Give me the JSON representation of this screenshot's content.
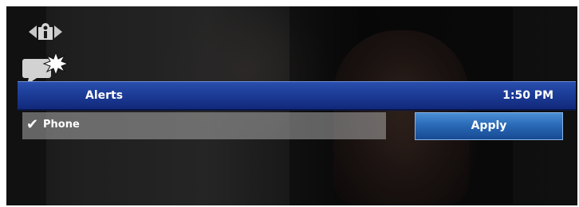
{
  "header": {
    "info_icon": "info-icon",
    "alert_icon": "new-alert-icon"
  },
  "alerts_bar": {
    "title": "Alerts",
    "time": "1:50 PM",
    "color": "#1c3c98"
  },
  "options": [
    {
      "label": "Phone",
      "checked": true
    }
  ],
  "actions": {
    "apply_label": "Apply",
    "color": "#2a6ab7"
  }
}
